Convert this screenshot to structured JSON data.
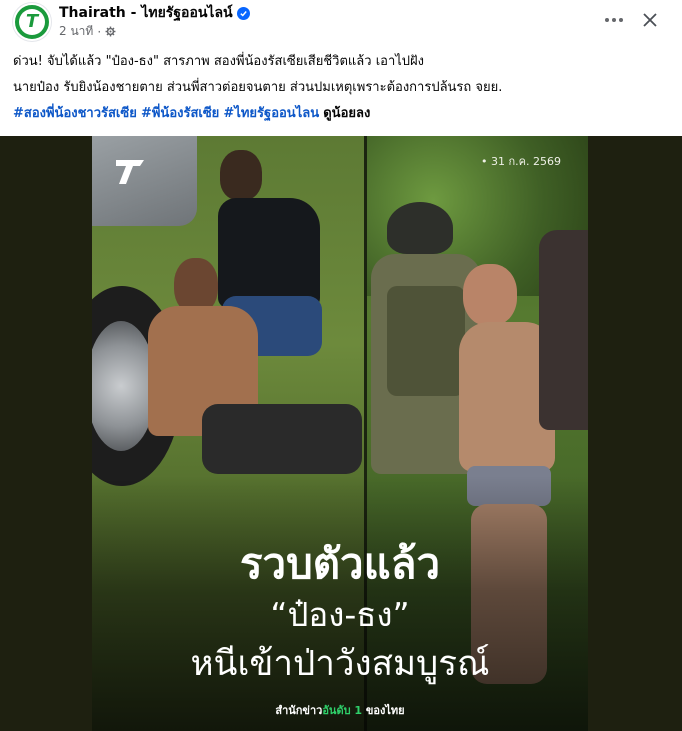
{
  "post": {
    "page_name": "Thairath - ไทยรัฐออนไลน์",
    "time": "2 นาที",
    "privacy_icon": "gear-icon",
    "verified_icon": "verified-badge-icon",
    "more_icon": "more-options-icon",
    "close_icon": "close-icon",
    "avatar_letter": "T"
  },
  "caption": {
    "line1": "ด่วน! จับได้แล้ว \"ป๋อง-ธง\" สารภาพ สองพี่น้องรัสเซียเสียชีวิตแล้ว เอาไปฝัง",
    "line2": "นายป๋อง รับยิงน้องชายตาย ส่วนพี่สาวต่อยจนตาย ส่วนปมเหตุเพราะต้องการปล้นรถ จยย.",
    "hashtags": [
      "#สองพี่น้องชาวรัสเซีย",
      "#พี่น้องรัสเซีย",
      "#ไทยรัฐออนไลน"
    ],
    "see_more": "ดูน้อยลง"
  },
  "media": {
    "date": "• 31 ก.ค. 2569",
    "headline": "รวบตัวแล้ว",
    "names": "“ป๋อง-ธง”",
    "subline": "หนีเข้าป่าวังสมบูรณ์",
    "footer_pre": "สำนักข่าว",
    "footer_hl": "อันดับ 1",
    "footer_post": " ของไทย",
    "colors": {
      "brand_green": "#1a9a3c",
      "accent_green": "#2fd06a",
      "link_blue": "#0d57c8"
    }
  }
}
